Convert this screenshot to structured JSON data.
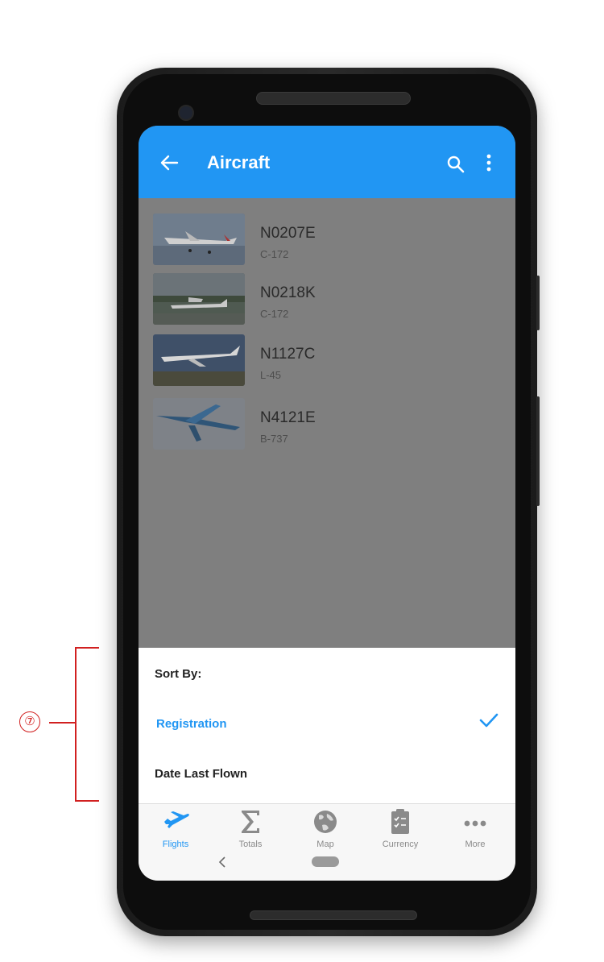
{
  "app": {
    "title": "Aircraft"
  },
  "aircraft": [
    {
      "registration": "N0207E",
      "model": "C-172"
    },
    {
      "registration": "N0218K",
      "model": "C-172"
    },
    {
      "registration": "N1127C",
      "model": "L-45"
    },
    {
      "registration": "N4121E",
      "model": "B-737"
    }
  ],
  "sort_sheet": {
    "heading": "Sort By:",
    "options": [
      {
        "label": "Registration",
        "selected": true
      },
      {
        "label": "Date Last Flown",
        "selected": false
      }
    ]
  },
  "bottom_nav": {
    "tabs": [
      {
        "label": "Flights",
        "icon": "airplane-icon",
        "active": true
      },
      {
        "label": "Totals",
        "icon": "sigma-icon",
        "active": false
      },
      {
        "label": "Map",
        "icon": "globe-icon",
        "active": false
      },
      {
        "label": "Currency",
        "icon": "clipboard-checklist-icon",
        "active": false
      },
      {
        "label": "More",
        "icon": "more-dots-icon",
        "active": false
      }
    ]
  },
  "annotation": {
    "marker": "⑦"
  },
  "colors": {
    "accent": "#2196f3",
    "annotation": "#d12020"
  }
}
